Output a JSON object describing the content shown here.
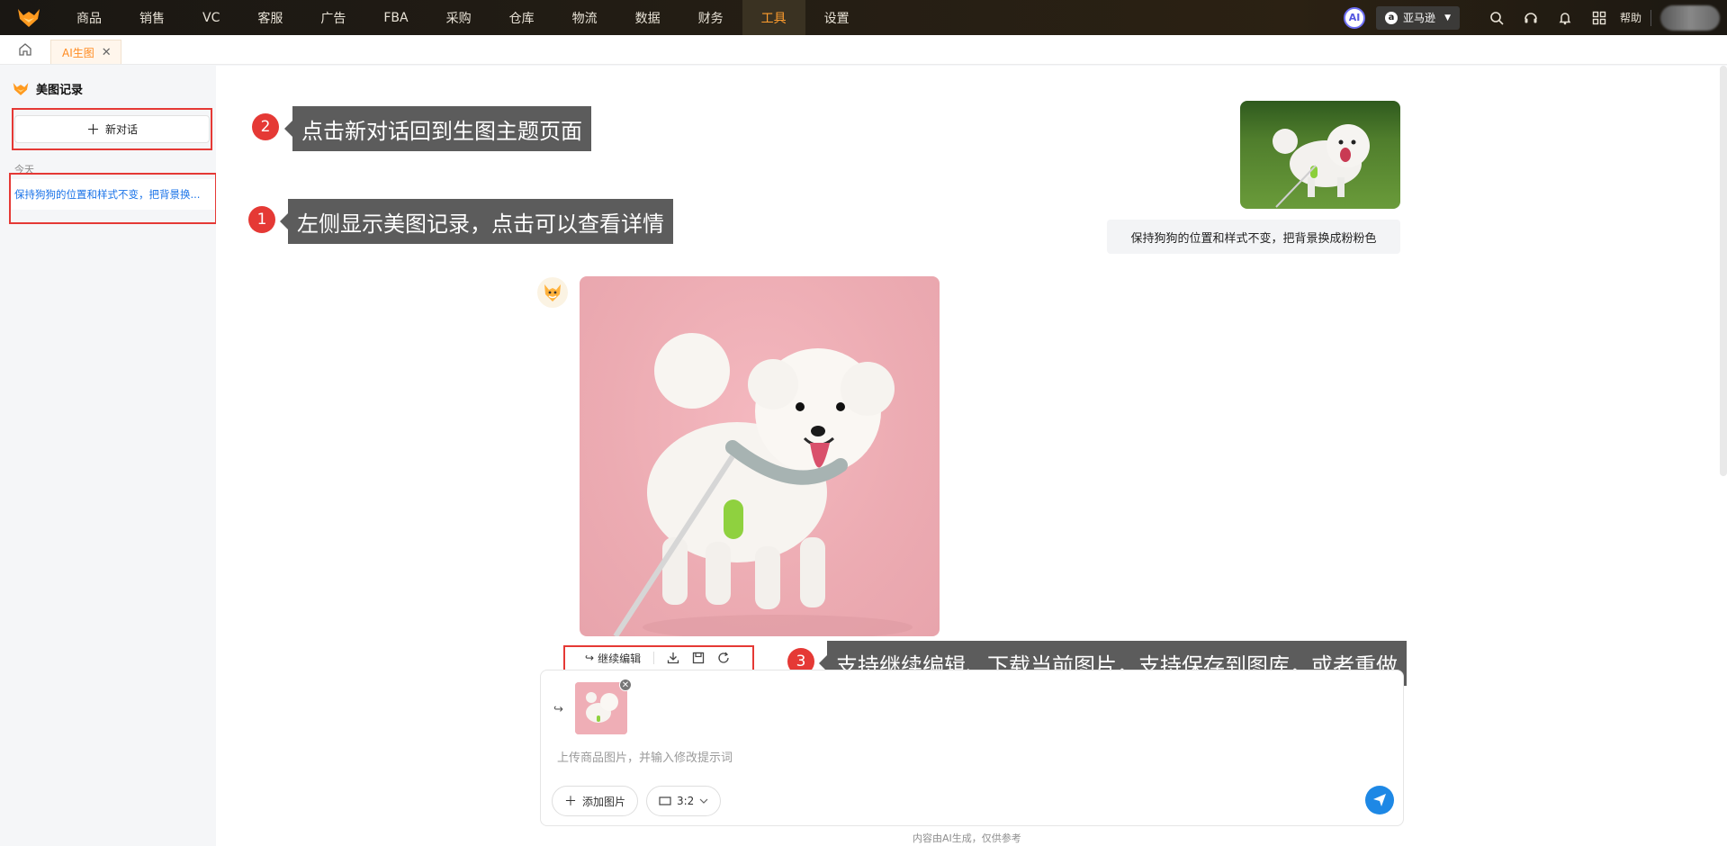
{
  "nav": {
    "items": [
      {
        "label": "商品"
      },
      {
        "label": "销售"
      },
      {
        "label": "VC"
      },
      {
        "label": "客服"
      },
      {
        "label": "广告"
      },
      {
        "label": "FBA"
      },
      {
        "label": "采购"
      },
      {
        "label": "仓库"
      },
      {
        "label": "物流"
      },
      {
        "label": "数据"
      },
      {
        "label": "财务"
      },
      {
        "label": "工具"
      },
      {
        "label": "设置"
      }
    ],
    "active_index": 11,
    "ai_badge": "AI",
    "site": "亚马逊",
    "help": "帮助"
  },
  "tabs": {
    "active": "AI生图"
  },
  "sidebar": {
    "title": "美图记录",
    "new_chat": "新对话",
    "section_today": "今天",
    "history": [
      "保持狗狗的位置和样式不变，把背景换..."
    ]
  },
  "callouts": {
    "c1_num": "1",
    "c1_text": "左侧显示美图记录，点击可以查看详情",
    "c2_num": "2",
    "c2_text": "点击新对话回到生图主题页面",
    "c3_num": "3",
    "c3_text": "支持继续编辑、下载当前图片，支持保存到图库，或者重做"
  },
  "chat": {
    "user_message": "保持狗狗的位置和样式不变，把背景换成粉粉色",
    "continue_edit": "继续编辑"
  },
  "composer": {
    "placeholder": "上传商品图片，并输入修改提示词",
    "add_image": "添加图片",
    "ratio": "3:2"
  },
  "disclaimer": "内容由AI生成，仅供参考",
  "colors": {
    "accent": "#ff8a1f",
    "highlight_red": "#e53935",
    "link_blue": "#1a73e8",
    "send_blue": "#1e88e5"
  }
}
